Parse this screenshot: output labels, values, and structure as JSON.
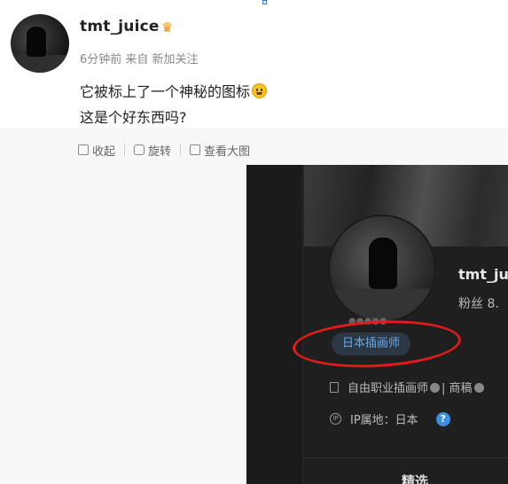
{
  "post": {
    "username": "tmt_juice",
    "crown_icon": "crown-icon",
    "meta": "6分钟前  来自 新加关注",
    "line1": "它被标上了一个神秘的图标",
    "line2": "这是个好东西吗?"
  },
  "toolbar": {
    "collapse_label": "收起",
    "rotate_label": "旋转",
    "view_large_label": "查看大图"
  },
  "screenshot": {
    "name": "tmt_ju",
    "fans": "粉丝 8.",
    "tag_small": "●●●●●",
    "tag": "日本插画师",
    "bio": "自由职业插画师",
    "bio_extra": "| 商稿",
    "ip": "IP属地：日本",
    "help_icon": "?",
    "tab": "精选",
    "colors": {
      "tag_text": "#6aa8e6",
      "tag_bg": "#2b3745",
      "annotation": "#e01b1b"
    }
  }
}
